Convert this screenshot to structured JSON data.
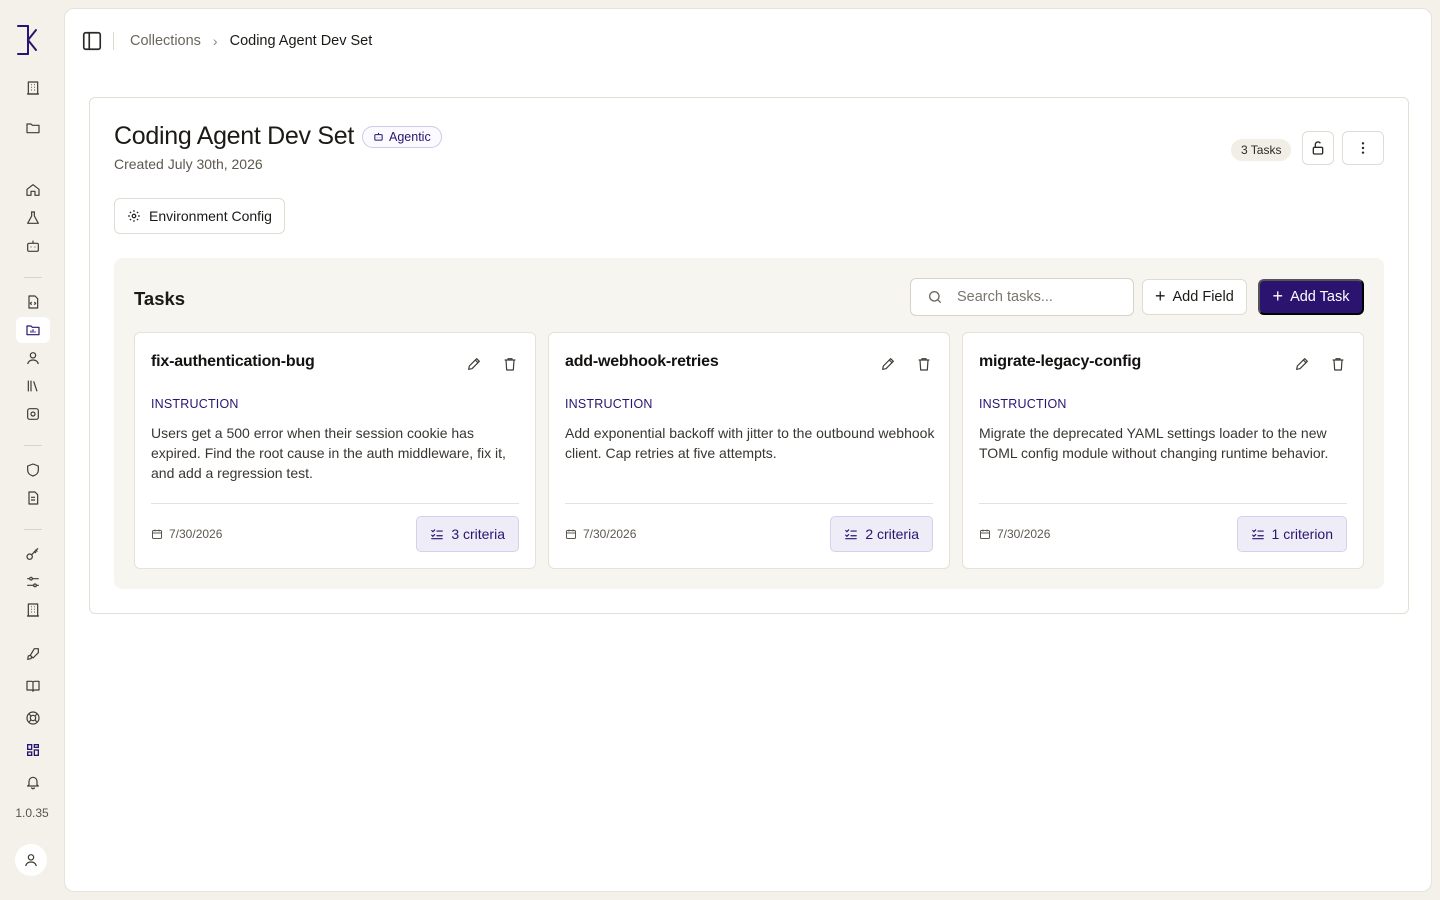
{
  "app": {
    "version": "1.0.35"
  },
  "sidebar": {
    "icons": [
      "logo-icon",
      "building-icon",
      "folder-icon",
      "home-icon",
      "flask-icon",
      "bot-icon",
      "file-code-icon",
      "folder-chart-icon",
      "user-icon",
      "library-icon",
      "settings-cog-icon",
      "shield-icon",
      "file-text-icon",
      "key-icon",
      "sliders-icon",
      "building-2-icon",
      "rocket-icon",
      "book-icon",
      "life-buoy-icon",
      "grid-icon",
      "bell-icon",
      "user-avatar-icon"
    ],
    "active": "folder-chart-icon"
  },
  "breadcrumb": {
    "parent": "Collections",
    "current": "Coding Agent Dev Set"
  },
  "collection": {
    "title": "Coding Agent Dev Set",
    "badge": "Agentic",
    "created": "Created July 30th, 2026",
    "task_count": "3 Tasks"
  },
  "env_config_label": "Environment Config",
  "tasks": {
    "heading": "Tasks",
    "search_placeholder": "Search tasks...",
    "add_field_label": "Add Field",
    "add_task_label": "Add Task",
    "items": [
      {
        "name": "fix-authentication-bug",
        "instruction_label": "INSTRUCTION",
        "instruction": "Users get a 500 error when their session cookie has expired. Find the root cause in the auth middleware, fix it, and add a regression test.",
        "date": "7/30/2026",
        "criteria": "3 criteria"
      },
      {
        "name": "add-webhook-retries",
        "instruction_label": "INSTRUCTION",
        "instruction": "Add exponential backoff with jitter to the outbound webhook client. Cap retries at five attempts.",
        "date": "7/30/2026",
        "criteria": "2 criteria"
      },
      {
        "name": "migrate-legacy-config",
        "instruction_label": "INSTRUCTION",
        "instruction": "Migrate the deprecated YAML settings loader to the new TOML config module without changing runtime behavior.",
        "date": "7/30/2026",
        "criteria": "1 criterion"
      }
    ]
  },
  "colors": {
    "accent": "#2a1470",
    "background": "#f4f1ea",
    "panel": "#f7f5ef"
  }
}
